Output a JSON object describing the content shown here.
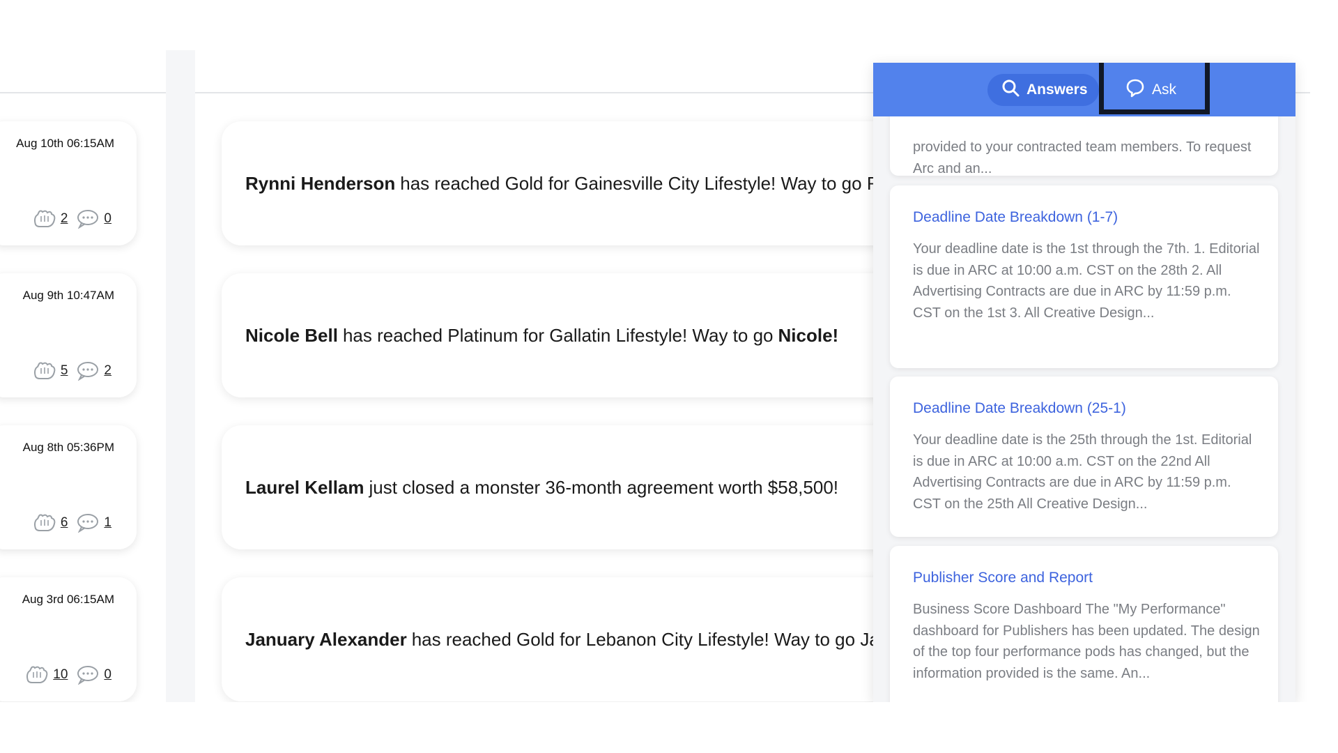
{
  "left_cards": [
    {
      "date": "Aug 10th 06:15AM",
      "likes": "2",
      "comments": "0"
    },
    {
      "date": "Aug 9th 10:47AM",
      "likes": "5",
      "comments": "2"
    },
    {
      "date": "Aug 8th 05:36PM",
      "likes": "6",
      "comments": "1"
    },
    {
      "date": "Aug 3rd 06:15AM",
      "likes": "10",
      "comments": "0"
    }
  ],
  "feed": [
    {
      "name": "Rynni Henderson",
      "text": "has reached Gold for Gainesville City Lifestyle! Way to go Rynni!",
      "end": ""
    },
    {
      "name": "Nicole Bell",
      "text": "has reached Platinum for Gallatin Lifestyle! Way to go",
      "end": "Nicole!"
    },
    {
      "name": "Laurel Kellam",
      "text": "just closed a monster 36-month agreement worth $58,500!",
      "end": ""
    },
    {
      "name": "January Alexander",
      "text": "has reached Gold for Lebanon City Lifestyle! Way to go January!",
      "end": ""
    }
  ],
  "panel": {
    "tabs": {
      "answers": "Answers",
      "ask": "Ask"
    },
    "partial_body": "provided to your contracted team members. To request Arc and an...",
    "articles": [
      {
        "title": "Deadline Date Breakdown (1-7)",
        "body": "Your deadline date is the 1st through the 7th. 1. Editorial is due in ARC at 10:00 a.m. CST on the 28th 2. All Advertising Contracts are due in ARC by 11:59 p.m. CST on the 1st 3. All Creative Design..."
      },
      {
        "title": "Deadline Date Breakdown (25-1)",
        "body": "Your deadline date is the 25th through the 1st. Editorial is due in ARC at 10:00 a.m. CST on the 22nd All Advertising Contracts are due in ARC by 11:59 p.m. CST on the 25th All Creative Design..."
      },
      {
        "title": "Publisher Score and Report",
        "body": "Business Score Dashboard The \"My Performance\" dashboard for Publishers has been updated. The design of the top four performance pods has changed, but the information provided is the same. An..."
      }
    ]
  },
  "colors": {
    "accent": "#5282ec",
    "link": "#3d63de"
  }
}
